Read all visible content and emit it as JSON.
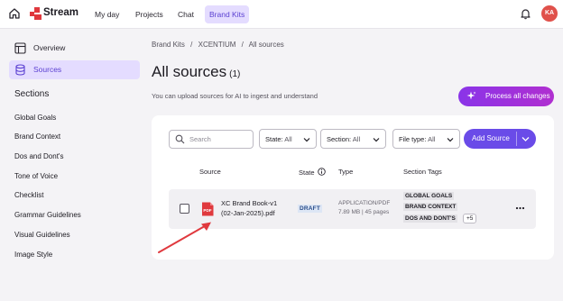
{
  "app": {
    "name": "Stream",
    "nav": [
      "My day",
      "Projects",
      "Chat",
      "Brand Kits"
    ],
    "active_nav": "Brand Kits",
    "user_initials": "KA"
  },
  "sidebar": {
    "links": [
      {
        "label": "Overview",
        "icon": "overview-icon"
      },
      {
        "label": "Sources",
        "icon": "database-icon",
        "active": true
      }
    ],
    "sections_title": "Sections",
    "sections": [
      "Global Goals",
      "Brand Context",
      "Dos and Dont's",
      "Tone of Voice",
      "Checklist",
      "Grammar Guidelines",
      "Visual Guidelines",
      "Image Style"
    ]
  },
  "main": {
    "breadcrumb": [
      "Brand Kits",
      "/",
      "XCENTIUM",
      "/",
      "All sources"
    ],
    "title": "All sources",
    "count": "(1)",
    "subtitle": "You can upload sources for AI to ingest and understand",
    "process_button": "Process all changes",
    "search_placeholder": "Search",
    "filters": [
      {
        "label": "State:",
        "value": "All"
      },
      {
        "label": "Section:",
        "value": "All"
      },
      {
        "label": "File type:",
        "value": "All"
      }
    ],
    "add_button": "Add Source",
    "columns": {
      "source": "Source",
      "state": "State",
      "type": "Type",
      "tags": "Section Tags"
    },
    "rows": [
      {
        "file_name": "XC Brand Book-v1 (02-Jan-2025).pdf",
        "state": "DRAFT",
        "type": "APPLICATION/PDF",
        "meta": "7.89 MB | 45 pages",
        "tags": [
          "GLOBAL GOALS",
          "BRAND CONTEXT",
          "DOS AND DONT'S"
        ],
        "more": "+5"
      }
    ]
  },
  "colors": {
    "accent": "#6a4be8",
    "annotation": "#e0393e",
    "pdf": "#e0393e"
  }
}
